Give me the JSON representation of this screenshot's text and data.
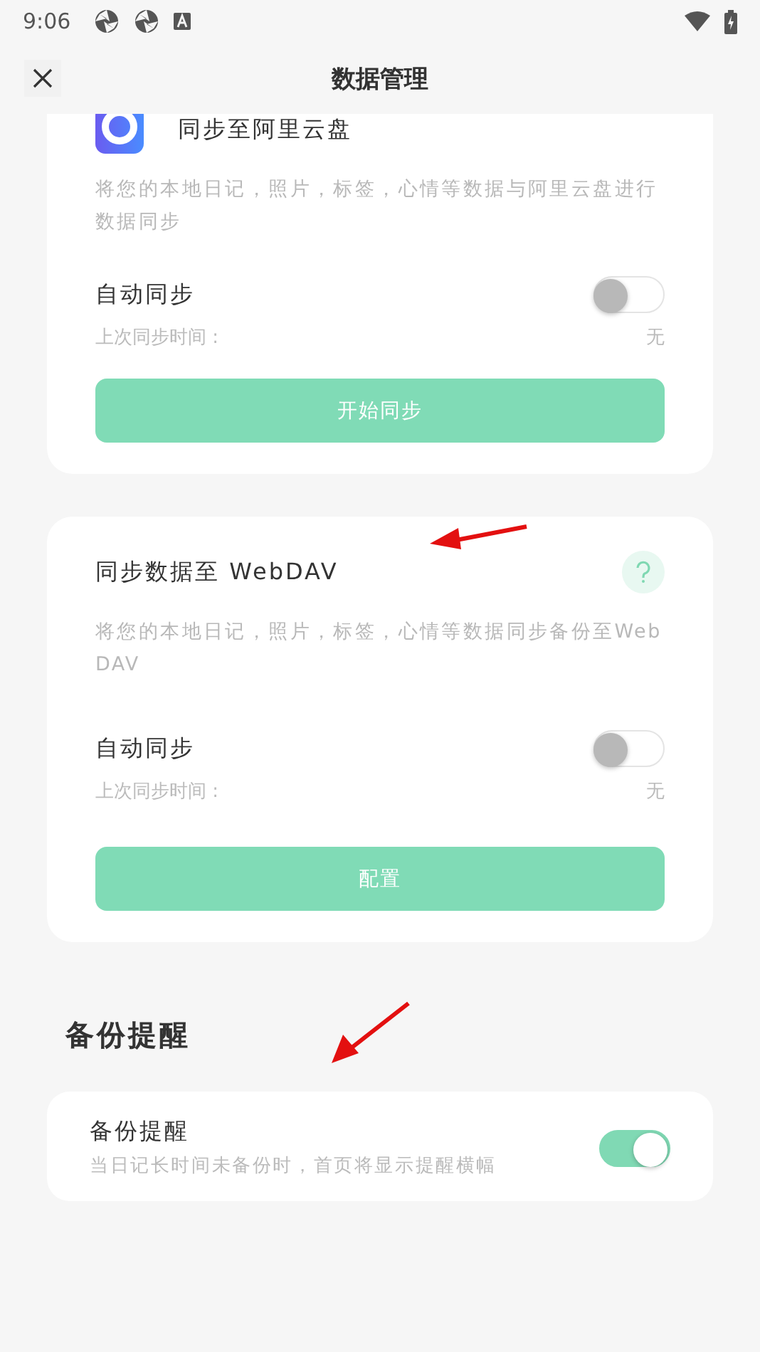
{
  "status_bar": {
    "time": "9:06"
  },
  "header": {
    "title": "数据管理"
  },
  "sync_cards": [
    {
      "kind": "aliyun",
      "title": "同步至阿里云盘",
      "description": "将您的本地日记，照片，标签，心情等数据与阿里云盘进行数据同步",
      "auto_sync": {
        "label": "自动同步",
        "on": false
      },
      "last_sync": {
        "label": "上次同步时间 :",
        "value": "无"
      },
      "button": "开始同步"
    },
    {
      "kind": "webdav",
      "title": "同步数据至 WebDAV",
      "description": "将您的本地日记，照片，标签，心情等数据同步备份至WebDAV",
      "auto_sync": {
        "label": "自动同步",
        "on": false
      },
      "last_sync": {
        "label": "上次同步时间 :",
        "value": "无"
      },
      "button": "配置"
    }
  ],
  "backup_section": {
    "heading": "备份提醒",
    "title": "备份提醒",
    "description": "当日记长时间未备份时，首页将显示提醒横幅",
    "on": true
  }
}
